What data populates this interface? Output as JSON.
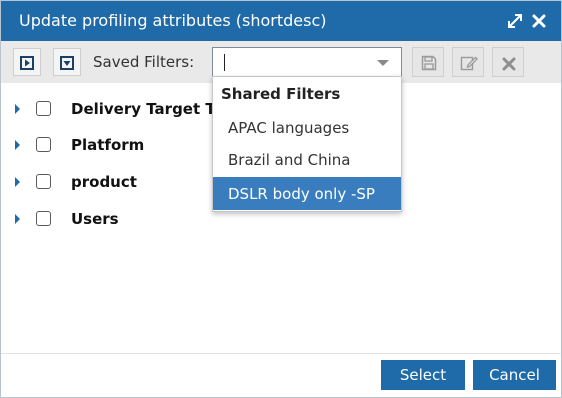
{
  "dialog": {
    "title": "Update profiling attributes (shortdesc)"
  },
  "toolbar": {
    "saved_filters_label": "Saved Filters:",
    "saved_filters_value": ""
  },
  "tree": {
    "items": [
      {
        "label": "Delivery Target Te",
        "checked": false
      },
      {
        "label": "Platform",
        "checked": false
      },
      {
        "label": "product",
        "checked": false
      },
      {
        "label": "Users",
        "checked": false
      }
    ]
  },
  "dropdown": {
    "header": "Shared Filters",
    "options": [
      {
        "label": "APAC languages",
        "selected": false
      },
      {
        "label": "Brazil and China",
        "selected": false
      },
      {
        "label": "DSLR body only -SP",
        "selected": true
      }
    ]
  },
  "footer": {
    "select_label": "Select",
    "cancel_label": "Cancel"
  },
  "colors": {
    "accent": "#1f6aa8",
    "selected_option": "#3a7dbf",
    "toolbar_bg": "#e9e9e9"
  }
}
